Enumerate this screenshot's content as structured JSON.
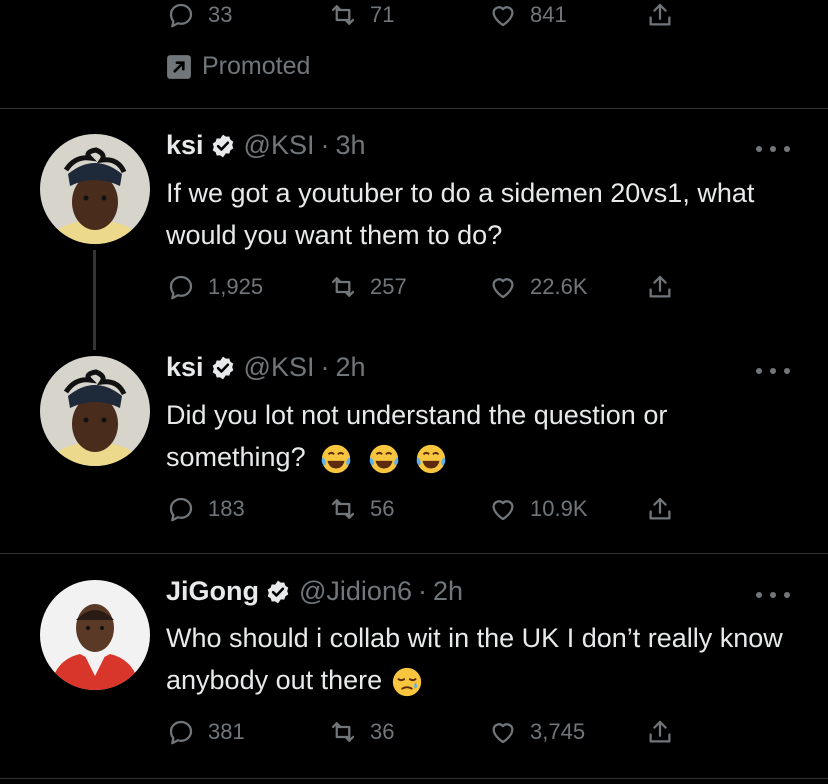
{
  "promoted_tweet": {
    "stats": {
      "replies": "33",
      "retweets": "71",
      "likes": "841"
    },
    "promoted_label": "Promoted"
  },
  "tweets": [
    {
      "name": "ksi",
      "handle": "@KSI",
      "time": "3h",
      "text": "If we got a youtuber to do a sidemen 20vs1, what would you want them to do?",
      "replies": "1,925",
      "retweets": "257",
      "likes": "22.6K"
    },
    {
      "name": "ksi",
      "handle": "@KSI",
      "time": "2h",
      "text": "Did you lot not understand the question or something?",
      "emoji": "face-with-tears-of-joy",
      "emoji_count": 3,
      "replies": "183",
      "retweets": "56",
      "likes": "10.9K"
    },
    {
      "name": "JiGong",
      "handle": "@Jidion6",
      "time": "2h",
      "text": "Who should i collab wit in the UK I don’t really  know anybody out there",
      "emoji": "sleepy-face",
      "replies": "381",
      "retweets": "36",
      "likes": "3,745"
    }
  ],
  "colors": {
    "background": "#000000",
    "primary_text": "#e7e9ea",
    "secondary_text": "#71767b",
    "divider": "#2f3336",
    "verified": "#e7e9ea"
  }
}
